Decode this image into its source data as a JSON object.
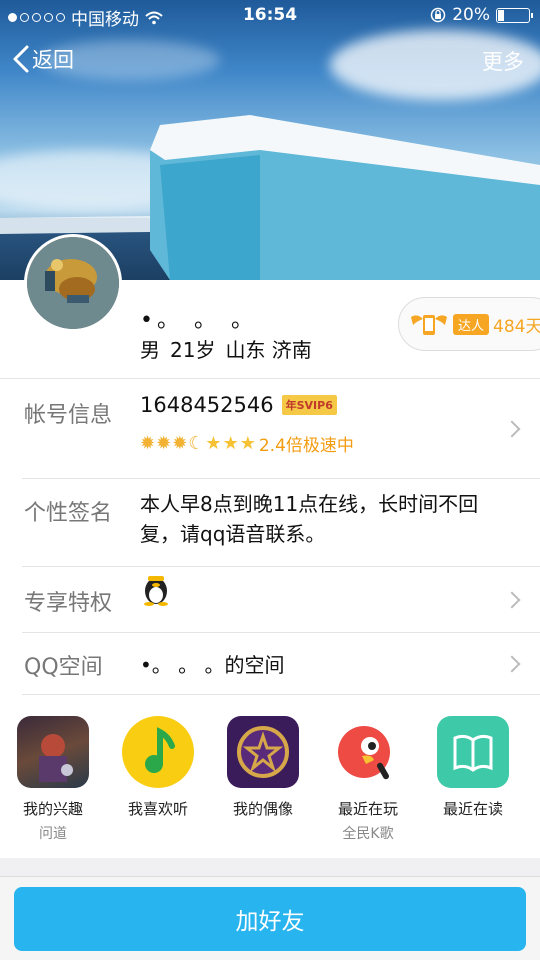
{
  "status": {
    "carrier": "中国移动",
    "time": "16:54",
    "battery": "20%",
    "battery_level": 0.2,
    "signal_dots_filled": 1
  },
  "nav": {
    "back_label": "返回",
    "more_label": "更多"
  },
  "profile": {
    "nickname": "•。 。 。",
    "gender": "男",
    "age": "21岁",
    "location": "山东 济南",
    "talent_tag": "达人",
    "talent_days": "484天"
  },
  "account": {
    "label": "帐号信息",
    "qq": "1648452546",
    "vip_badge": "年SVIP6",
    "speed": "2.4倍极速中"
  },
  "signature": {
    "label": "个性签名",
    "text": "本人早8点到晚11点在线，长时间不回复，请qq语音联系。"
  },
  "privilege": {
    "label": "专享特权"
  },
  "qzone": {
    "label": "QQ空间",
    "name": "•。 。 。的空间"
  },
  "apps": [
    {
      "title": "我的兴趣",
      "sub": "问道",
      "icon": "game-avatar-icon"
    },
    {
      "title": "我喜欢听",
      "sub": "",
      "icon": "qq-music-icon"
    },
    {
      "title": "我的偶像",
      "sub": "",
      "icon": "idol-star-icon"
    },
    {
      "title": "最近在玩",
      "sub": "全民K歌",
      "icon": "karaoke-icon"
    },
    {
      "title": "最近在读",
      "sub": "",
      "icon": "book-icon"
    }
  ],
  "footer": {
    "add_friend": "加好友"
  },
  "colors": {
    "accent": "#28b4ef",
    "gold": "#f39c12"
  }
}
